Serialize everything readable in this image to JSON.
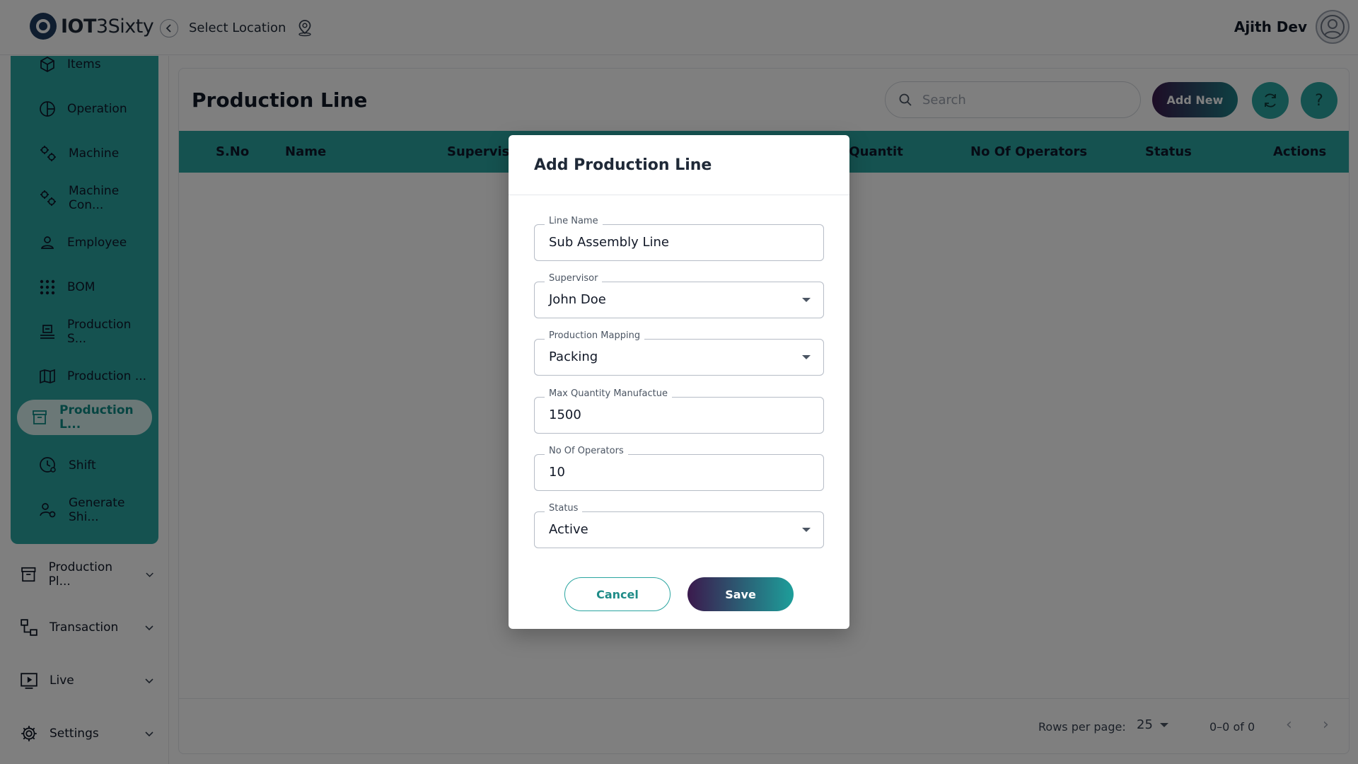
{
  "app": {
    "logo_bold": "IOT",
    "logo_rest": "3Sixty",
    "select_location": "Select Location",
    "user_name": "Ajith Dev"
  },
  "sidebar": {
    "sub_items": [
      {
        "label": "Items",
        "icon": "box-icon"
      },
      {
        "label": "Operation",
        "icon": "pie-icon"
      },
      {
        "label": "Machine",
        "icon": "gears-icon"
      },
      {
        "label": "Machine Con...",
        "icon": "gears-icon"
      },
      {
        "label": "Employee",
        "icon": "person-icon"
      },
      {
        "label": "BOM",
        "icon": "dots-grid-icon"
      },
      {
        "label": "Production S...",
        "icon": "desk-icon"
      },
      {
        "label": "Production ...",
        "icon": "map-icon"
      },
      {
        "label": "Production L...",
        "icon": "archive-icon",
        "active": true
      },
      {
        "label": "Shift",
        "icon": "clock-person-icon"
      },
      {
        "label": "Generate Shi...",
        "icon": "person-gear-icon"
      }
    ],
    "groups": [
      {
        "label": "Production Pl...",
        "icon": "archive-icon"
      },
      {
        "label": "Transaction",
        "icon": "flow-icon"
      },
      {
        "label": "Live",
        "icon": "play-icon"
      },
      {
        "label": "Settings",
        "icon": "gear-icon"
      }
    ]
  },
  "main": {
    "title": "Production Line",
    "search_placeholder": "Search",
    "add_new": "Add New",
    "columns": [
      "S.No",
      "Name",
      "Supervisor",
      "re Quantit",
      "No Of Operators",
      "Status",
      "Actions"
    ],
    "footer": {
      "rows_per_page_label": "Rows per page:",
      "rows_per_page_value": "25",
      "range": "0–0 of 0"
    }
  },
  "modal": {
    "title": "Add Production Line",
    "fields": [
      {
        "label": "Line Name",
        "value": "Sub Assembly Line",
        "type": "text"
      },
      {
        "label": "Supervisor",
        "value": "John Doe",
        "type": "select"
      },
      {
        "label": "Production Mapping",
        "value": "Packing",
        "type": "select"
      },
      {
        "label": "Max Quantity Manufactue",
        "value": "1500",
        "type": "text"
      },
      {
        "label": "No Of Operators",
        "value": "10",
        "type": "text"
      },
      {
        "label": "Status",
        "value": "Active",
        "type": "select"
      }
    ],
    "cancel_label": "Cancel",
    "save_label": "Save"
  },
  "colors": {
    "accent": "#2aa5a0",
    "gradient_start": "#3b1a4d",
    "gradient_end": "#1d9e9a"
  }
}
